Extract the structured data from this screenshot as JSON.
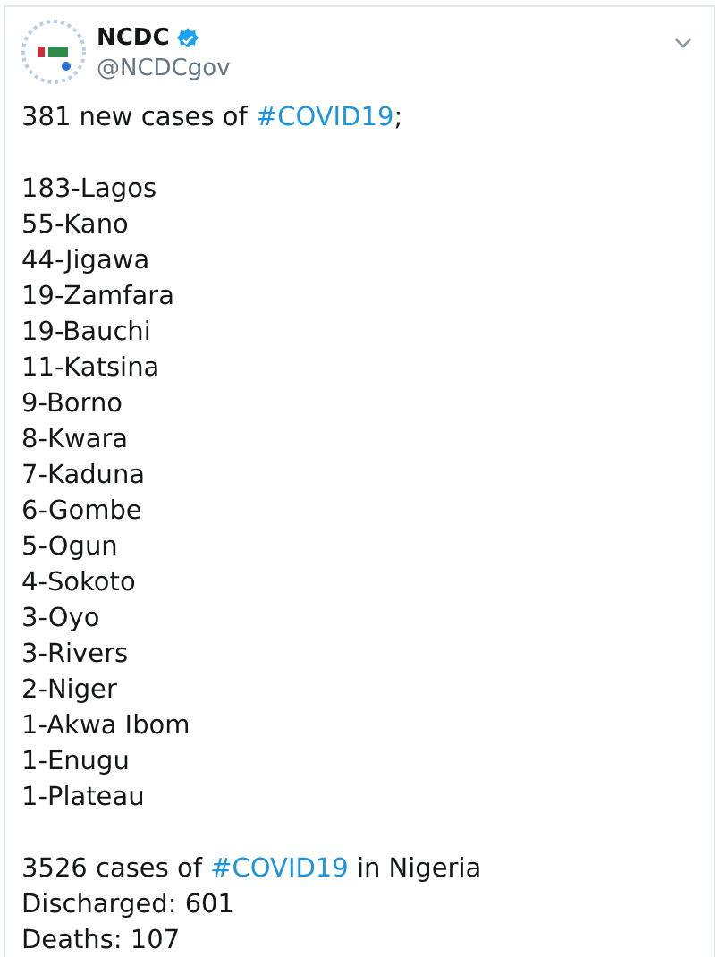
{
  "tweet": {
    "name": "NCDC",
    "verified": true,
    "handle": "@NCDCgov",
    "intro": {
      "text": "381 new cases of ",
      "hashtag": "#COVID19",
      "suffix": ";"
    },
    "lines": [
      "183-Lagos",
      "55-Kano",
      "44-Jigawa",
      "19-Zamfara",
      "19-Bauchi",
      "11-Katsina",
      "9-Borno",
      "8-Kwara",
      "7-Kaduna",
      "6-Gombe",
      "5-Ogun",
      "4-Sokoto",
      "3-Oyo",
      "3-Rivers",
      "2-Niger",
      "1-Akwa Ibom",
      "1-Enugu",
      "1-Plateau"
    ],
    "summary": {
      "text": "3526 cases of ",
      "hashtag": "#COVID19",
      "suffix": " in Nigeria"
    },
    "stats": [
      "Discharged: 601",
      "Deaths: 107"
    ]
  }
}
